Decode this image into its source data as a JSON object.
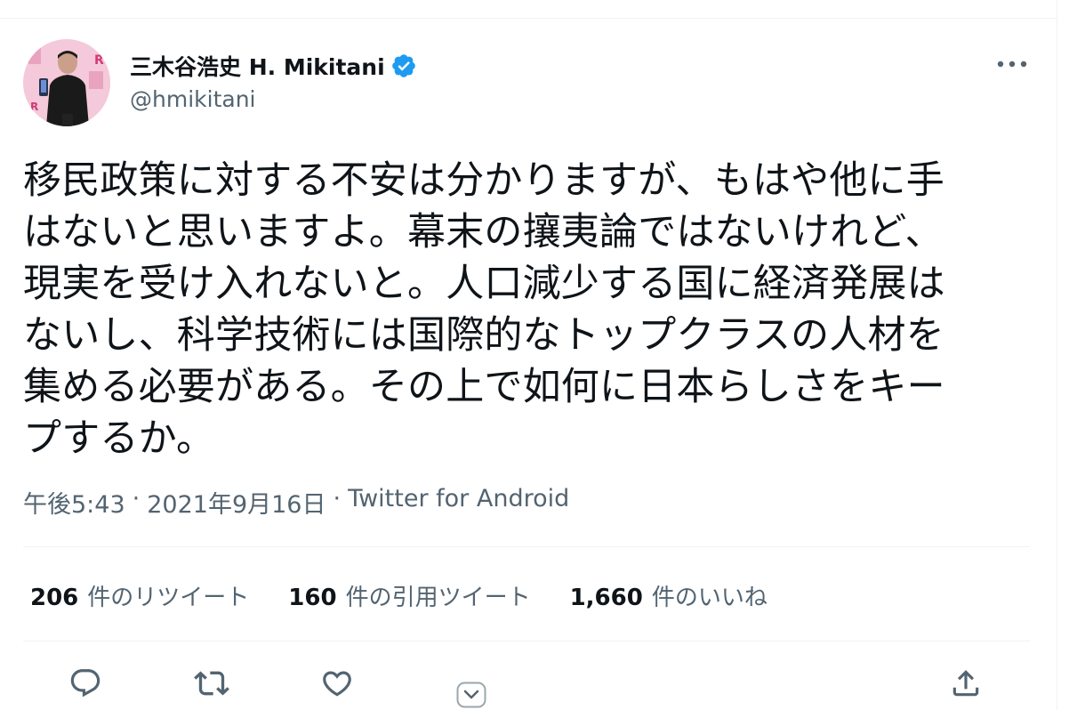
{
  "author": {
    "display_name": "三木谷浩史 H. Mikitani",
    "handle": "@hmikitani",
    "verified": true,
    "avatar_sign_letter": "R"
  },
  "tweet": {
    "text_lines": [
      "移民政策に対する不安は分かりますが、もはや他に手",
      "はないと思いますよ。幕末の攘夷論ではないけれど、",
      "現実を受け入れないと。人口減少する国に経済発展は",
      "ないし、科学技術には国際的なトップクラスの人材を",
      "集める必要がある。その上で如何に日本らしさをキー",
      "プするか。"
    ],
    "time": "午後5:43",
    "date": "2021年9月16日",
    "source": "Twitter for Android",
    "separator": "·"
  },
  "stats": {
    "retweets": {
      "count": "206",
      "label": "件のリツイート"
    },
    "quotes": {
      "count": "160",
      "label": "件の引用ツイート"
    },
    "likes": {
      "count": "1,660",
      "label": "件のいいね"
    }
  },
  "actions": [
    "reply-icon",
    "retweet-icon",
    "like-icon",
    "share-icon"
  ],
  "colors": {
    "text": "#0f1419",
    "secondary": "#536471",
    "divider": "#eff3f4",
    "verified": "#1d9bf0",
    "avatar_bg": "#f3c6d8"
  }
}
